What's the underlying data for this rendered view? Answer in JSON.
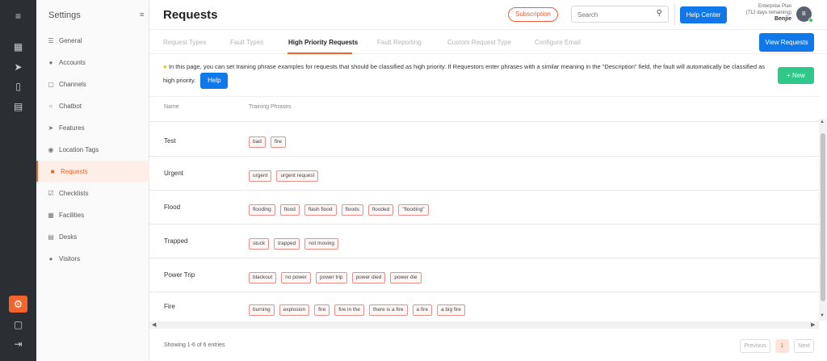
{
  "header": {
    "title": "Requests",
    "subscription_label": "Subscription",
    "search_placeholder": "Search",
    "help_center_label": "Help Center",
    "plan_name": "Enterprise Plan",
    "plan_days": "(712 days remaining)",
    "user_name": "Benjie",
    "avatar_initial": "B"
  },
  "rail": {
    "icons": [
      "menu-icon",
      "dashboard-icon",
      "rocket-icon",
      "stats-icon",
      "chart-icon",
      "gear-icon",
      "cube-icon",
      "logout-icon"
    ]
  },
  "sidebar": {
    "title": "Settings",
    "items": [
      {
        "label": "General",
        "icon": "sliders-icon"
      },
      {
        "label": "Accounts",
        "icon": "users-icon"
      },
      {
        "label": "Channels",
        "icon": "channels-icon"
      },
      {
        "label": "Chatbot",
        "icon": "chat-icon"
      },
      {
        "label": "Features",
        "icon": "rocket-icon"
      },
      {
        "label": "Location Tags",
        "icon": "location-icon"
      },
      {
        "label": "Requests",
        "icon": "request-icon",
        "active": true
      },
      {
        "label": "Checklists",
        "icon": "checklist-icon"
      },
      {
        "label": "Facilities",
        "icon": "facilities-icon"
      },
      {
        "label": "Desks",
        "icon": "desk-icon"
      },
      {
        "label": "Visitors",
        "icon": "visitors-icon"
      }
    ]
  },
  "tabs": [
    {
      "label": "Request Types"
    },
    {
      "label": "Fault Types"
    },
    {
      "label": "High Priority Requests",
      "active": true
    },
    {
      "label": "Fault Reporting"
    },
    {
      "label": "Custom Request Type"
    },
    {
      "label": "Configure Email"
    }
  ],
  "view_requests_label": "View Requests",
  "info": {
    "text": "In this page, you can set training phrase examples for requests that should be classified as high priority. If Requestors enter phrases with a similar meaning in the \"Description\" field, the fault will automatically be classified as high priority.",
    "help_label": "Help"
  },
  "new_label": "+ New",
  "table": {
    "columns": [
      "Name",
      "Training Phrases"
    ],
    "rows": [
      {
        "name": "Test",
        "phrases": [
          "bad",
          "fire"
        ]
      },
      {
        "name": "Urgent",
        "phrases": [
          "urgent",
          "urgent request"
        ]
      },
      {
        "name": "Flood",
        "phrases": [
          "flooding",
          "flood",
          "flash flood",
          "floods",
          "flooded",
          "\"flooding\""
        ]
      },
      {
        "name": "Trapped",
        "phrases": [
          "stuck",
          "trapped",
          "not moving"
        ]
      },
      {
        "name": "Power Trip",
        "phrases": [
          "blackout",
          "no power",
          "power trip",
          "power died",
          "power die"
        ]
      },
      {
        "name": "Fire",
        "phrases": [
          "burning",
          "explosion",
          "fire",
          "fire in the",
          "there is a fire",
          "a fire",
          "a big fire"
        ]
      }
    ]
  },
  "footer": {
    "showing": "Showing 1-6 of 6 entries",
    "previous": "Previous",
    "page": "1",
    "next": "Next"
  },
  "colors": {
    "accent": "#f2642c",
    "primary": "#1078e8",
    "success": "#2ec88a",
    "rail": "#2b2f33"
  }
}
